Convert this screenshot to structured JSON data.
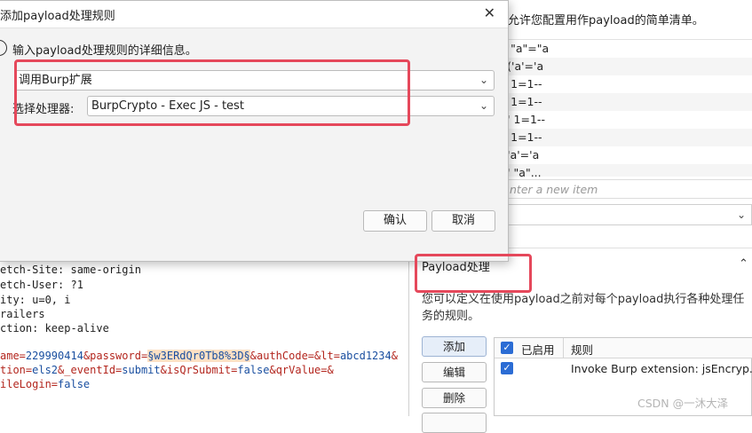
{
  "background": {
    "top_text": "允许您配置用作payload的简单清单。",
    "payload_list": [
      "r \"a\"=\"a",
      "r('a'='a",
      "r 1=1--",
      "r 1=1--",
      "r' 1=1--",
      "r 1=1--",
      "r'a'='a",
      "r' \"a\"..."
    ],
    "enter_item_placeholder": "nter a new item",
    "processing_title": "Payload处理",
    "processing_desc": "您可以定义在使用payload之前对每个payload执行各种处理任务的规则。",
    "buttons": {
      "add": "添加",
      "edit": "编辑",
      "delete": "删除"
    },
    "rules_table": {
      "col_enabled": "已启用",
      "col_rule": "规则",
      "rows": [
        {
          "enabled": true,
          "rule": "Invoke Burp extension: jsEncryp..."
        }
      ]
    },
    "request_lines": {
      "l1": "etch-Site: same-origin",
      "l2": "etch-User: ?1",
      "l3": "ity: u=0, i",
      "l4": "railers",
      "l5": "ction: keep-alive",
      "l6a": "ame=",
      "l6b": "229990414",
      "l6c": "&password=",
      "l6d": "§w3ERdQr0Tb8%3D§",
      "l6e": "&authCode=&lt=",
      "l6f": "abcd1234",
      "l6g": "&",
      "l7a": "tion=",
      "l7b": "els2",
      "l7c": "&_eventId=",
      "l7d": "submit",
      "l7e": "&isQrSubmit=",
      "l7f": "false",
      "l7g": "&qrValue=&",
      "l8a": "ileLogin=",
      "l8b": "false"
    },
    "watermark": "CSDN @一沐大泽"
  },
  "dialog": {
    "title": "添加payload处理规则",
    "instruction": "输入payload处理规则的详细信息。",
    "rule_type_value": "调用Burp扩展",
    "processor_label": "选择处理器:",
    "processor_value": "BurpCrypto - Exec JS - test",
    "ok_label": "确认",
    "cancel_label": "取消"
  },
  "colors": {
    "annotation_red": "#e5485b",
    "checkbox_blue": "#2b6cd4",
    "dialog_bg": "#f3f3f3"
  }
}
